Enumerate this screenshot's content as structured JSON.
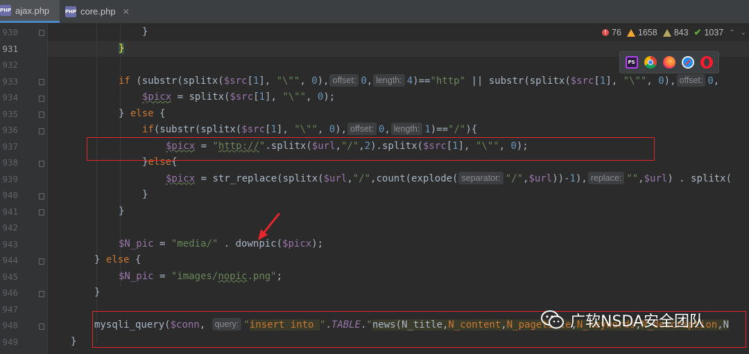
{
  "tabs": [
    {
      "label": "ajax.php",
      "active": true,
      "icon": "php-file-icon"
    },
    {
      "label": "core.php",
      "active": false,
      "icon": "php-file-icon"
    }
  ],
  "inspections": {
    "errors": "76",
    "warnings": "1658",
    "weak_warnings": "843",
    "typos": "1037"
  },
  "browsers": [
    "phpstorm-icon",
    "chrome-icon",
    "firefox-icon",
    "safari-icon",
    "opera-icon"
  ],
  "line_numbers": [
    "930",
    "931",
    "932",
    "933",
    "934",
    "935",
    "936",
    "937",
    "938",
    "939",
    "940",
    "941",
    "942",
    "943",
    "944",
    "945",
    "946",
    "947",
    "948",
    "949"
  ],
  "current_line": "931",
  "hints": {
    "offset": "offset:",
    "length": "length:",
    "separator": "separator:",
    "replace": "replace:",
    "query": "query:"
  },
  "watermark": "广软NSDA安全团队",
  "colors": {
    "background": "#2b2b2b",
    "keyword": "#cc7832",
    "variable": "#9876aa",
    "string": "#6a8759",
    "number": "#6897bb",
    "annotation": "#e8252a"
  }
}
